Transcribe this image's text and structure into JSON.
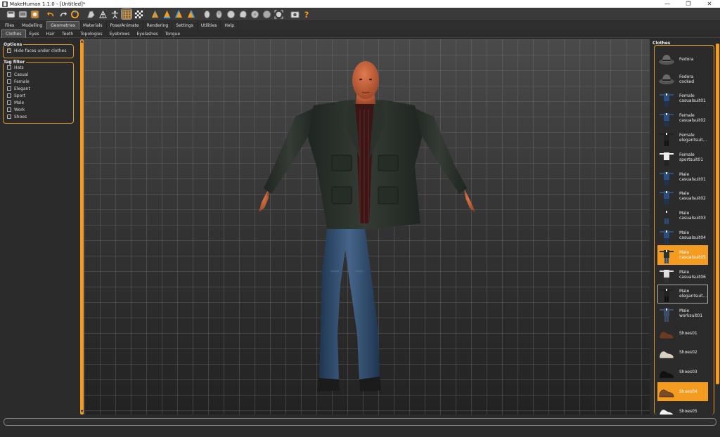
{
  "window": {
    "title": "MakeHuman 1.1.0 - [Untitled]*",
    "controls": [
      "minimize",
      "maximize",
      "close"
    ]
  },
  "toolbar": {
    "icons": [
      "save-icon",
      "load-icon",
      "export-icon",
      "undo-icon",
      "redo-icon",
      "reset-icon",
      "smooth-icon",
      "wireframe-icon",
      "pose-icon",
      "grid-icon",
      "chessboard-icon",
      "front-view-icon",
      "back-view-icon",
      "left-view-icon",
      "right-view-icon",
      "top-view-icon",
      "bottom-view-icon",
      "reset-camera-icon",
      "screenshot-icon",
      "help-icon"
    ],
    "active": "grid-icon"
  },
  "main_tabs": {
    "items": [
      "Files",
      "Modelling",
      "Geometries",
      "Materials",
      "Pose/Animate",
      "Rendering",
      "Settings",
      "Utilities",
      "Help"
    ],
    "active": "Geometries"
  },
  "sub_tabs": {
    "items": [
      "Clothes",
      "Eyes",
      "Hair",
      "Teeth",
      "Topologies",
      "Eyebrows",
      "Eyelashes",
      "Tongue"
    ],
    "active": "Clothes"
  },
  "options": {
    "title": "Options",
    "hide_faces_label": "Hide faces under clothes",
    "hide_faces_checked": true
  },
  "tag_filter": {
    "title": "Tag filter",
    "items": [
      "Hats",
      "Casual",
      "Female",
      "Elegant",
      "Sport",
      "Male",
      "Work",
      "Shoes"
    ]
  },
  "clothes": {
    "title": "Clothes",
    "items": [
      {
        "label": "Fedora",
        "icon": "fedora-thumb",
        "selected": false
      },
      {
        "label": "Fedora cocked",
        "icon": "fedora-cocked-thumb",
        "selected": false
      },
      {
        "label": "Female casualsuit01",
        "icon": "female-casualsuit01-thumb",
        "selected": false
      },
      {
        "label": "Female casualsuit02",
        "icon": "female-casualsuit02-thumb",
        "selected": false
      },
      {
        "label": "Female elegantsuit...",
        "icon": "female-elegantsuit-thumb",
        "selected": false
      },
      {
        "label": "Female sportsuit01",
        "icon": "female-sportsuit01-thumb",
        "selected": false
      },
      {
        "label": "Male casualsuit01",
        "icon": "male-casualsuit01-thumb",
        "selected": false
      },
      {
        "label": "Male casualsuit02",
        "icon": "male-casualsuit02-thumb",
        "selected": false
      },
      {
        "label": "Male casualsuit03",
        "icon": "male-casualsuit03-thumb",
        "selected": false
      },
      {
        "label": "Male casualsuit04",
        "icon": "male-casualsuit04-thumb",
        "selected": false
      },
      {
        "label": "Male casualsuit05",
        "icon": "male-casualsuit05-thumb",
        "selected": true
      },
      {
        "label": "Male casualsuit06",
        "icon": "male-casualsuit06-thumb",
        "selected": false
      },
      {
        "label": "Male elegantsuit...",
        "icon": "male-elegantsuit-thumb",
        "selected": false
      },
      {
        "label": "Male worksuit01",
        "icon": "male-worksuit01-thumb",
        "selected": false
      },
      {
        "label": "Shoes01",
        "icon": "shoes01-thumb",
        "selected": false
      },
      {
        "label": "Shoes02",
        "icon": "shoes02-thumb",
        "selected": false
      },
      {
        "label": "Shoes03",
        "icon": "shoes03-thumb",
        "selected": false
      },
      {
        "label": "Shoes04",
        "icon": "shoes04-thumb",
        "selected": true
      },
      {
        "label": "Shoes05",
        "icon": "shoes05-thumb",
        "selected": false
      }
    ]
  },
  "colors": {
    "accent": "#f39c1f",
    "panel_bg": "#2b2b2b",
    "viewport_grid": "#777777"
  },
  "status": {
    "text": ""
  }
}
